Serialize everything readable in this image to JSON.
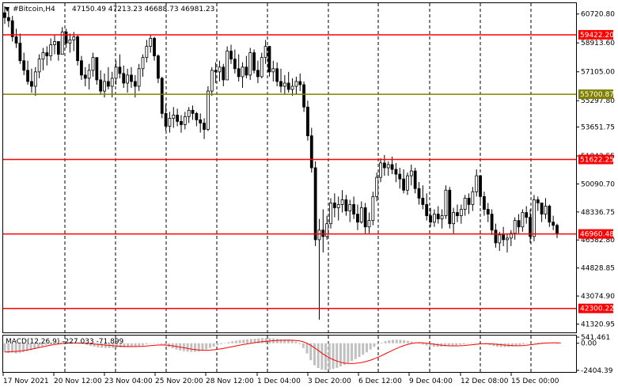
{
  "header": {
    "symbol": "#Bitcoin,H4",
    "ohlc": "47150.49 47213.23 46688.73 46981.23"
  },
  "chart_data": {
    "type": "candlestick",
    "timeframe": "H4",
    "price_ylim": [
      40800,
      61400
    ],
    "price_ticks": [
      60720.8,
      58913.6,
      57105.0,
      55297.8,
      53651.75,
      51843.55,
      50090.7,
      48336.75,
      46582.8,
      44828.85,
      43074.9,
      41320.95
    ],
    "price_tick_labels": [
      "60720.80",
      "58913.60",
      "57105.00",
      "55297.80",
      "53651.75",
      "51843.55",
      "50090.70",
      "48336.75",
      "46582.80",
      "44828.85",
      "43074.90",
      "41320.95"
    ],
    "levels": [
      {
        "price": 59422.2,
        "label": "59422.20",
        "color": "#ff0000"
      },
      {
        "price": 55700.87,
        "label": "55700.87",
        "color": "#808000"
      },
      {
        "price": 51622.25,
        "label": "51622.25",
        "color": "#ff0000"
      },
      {
        "price": 46960.48,
        "label": "46960.48",
        "color": "#ff0000"
      },
      {
        "price": 42300.22,
        "label": "42300.22",
        "color": "#ff0000"
      }
    ],
    "x_labels": [
      "17 Nov 2021",
      "20 Nov 12:00",
      "23 Nov 04:00",
      "25 Nov 20:00",
      "28 Nov 12:00",
      "1 Dec 04:00",
      "3 Dec 20:00",
      "6 Dec 12:00",
      "9 Dec 04:00",
      "12 Dec 08:00",
      "15 Dec 00:00"
    ],
    "candles_hlc": [
      [
        61200,
        60100,
        60500
      ],
      [
        61100,
        59900,
        60300
      ],
      [
        60600,
        59000,
        59300
      ],
      [
        59800,
        58600,
        58900
      ],
      [
        59500,
        57600,
        57800
      ],
      [
        58300,
        56900,
        57200
      ],
      [
        57800,
        56300,
        56500
      ],
      [
        57300,
        55800,
        56200
      ],
      [
        57400,
        55600,
        57100
      ],
      [
        58200,
        56700,
        57900
      ],
      [
        58600,
        57200,
        58300
      ],
      [
        58700,
        57500,
        58100
      ],
      [
        59200,
        57800,
        58800
      ],
      [
        59400,
        58200,
        59000
      ],
      [
        59000,
        57800,
        58200
      ],
      [
        59900,
        58500,
        59600
      ],
      [
        59800,
        58600,
        58900
      ],
      [
        59500,
        58300,
        59100
      ],
      [
        59600,
        58400,
        59300
      ],
      [
        59400,
        57500,
        57800
      ],
      [
        58100,
        56600,
        56900
      ],
      [
        57400,
        56200,
        56700
      ],
      [
        57600,
        56000,
        57200
      ],
      [
        58300,
        56800,
        58000
      ],
      [
        58000,
        56300,
        56600
      ],
      [
        57200,
        55700,
        55900
      ],
      [
        57000,
        55500,
        56500
      ],
      [
        57400,
        56000,
        56200
      ],
      [
        57100,
        55500,
        56700
      ],
      [
        57800,
        56300,
        57400
      ],
      [
        58200,
        56700,
        57000
      ],
      [
        57500,
        56100,
        56400
      ],
      [
        57300,
        55800,
        56900
      ],
      [
        57400,
        56100,
        56500
      ],
      [
        56900,
        55500,
        56200
      ],
      [
        57600,
        55900,
        57300
      ],
      [
        58200,
        56800,
        58000
      ],
      [
        59100,
        57700,
        58700
      ],
      [
        59400,
        58300,
        59200
      ],
      [
        59300,
        57800,
        58100
      ],
      [
        58200,
        56400,
        56700
      ],
      [
        56800,
        54200,
        54500
      ],
      [
        55100,
        53400,
        53700
      ],
      [
        54600,
        53300,
        54200
      ],
      [
        54900,
        53600,
        54400
      ],
      [
        54800,
        53700,
        54000
      ],
      [
        54400,
        53300,
        53800
      ],
      [
        54600,
        53500,
        54300
      ],
      [
        54900,
        53900,
        54700
      ],
      [
        55000,
        54100,
        54500
      ],
      [
        54600,
        53700,
        54100
      ],
      [
        54500,
        53300,
        53900
      ],
      [
        54200,
        52900,
        53500
      ],
      [
        56200,
        53400,
        55900
      ],
      [
        57400,
        55600,
        57200
      ],
      [
        57700,
        56400,
        57100
      ],
      [
        57800,
        56500,
        57400
      ],
      [
        57600,
        56200,
        56600
      ],
      [
        58700,
        56800,
        58400
      ],
      [
        58800,
        57600,
        57900
      ],
      [
        58500,
        57000,
        57300
      ],
      [
        58200,
        56500,
        56800
      ],
      [
        57700,
        56100,
        57400
      ],
      [
        58100,
        56700,
        56900
      ],
      [
        58600,
        56600,
        58300
      ],
      [
        58500,
        57000,
        57200
      ],
      [
        57800,
        56400,
        56800
      ],
      [
        58300,
        56700,
        58000
      ],
      [
        59100,
        57600,
        58700
      ],
      [
        58500,
        56800,
        57100
      ],
      [
        57800,
        56500,
        57300
      ],
      [
        57700,
        56200,
        56500
      ],
      [
        57300,
        55800,
        56200
      ],
      [
        56900,
        55700,
        56400
      ],
      [
        57100,
        55800,
        56000
      ],
      [
        56700,
        55600,
        56200
      ],
      [
        56800,
        55700,
        56500
      ],
      [
        57000,
        55900,
        56300
      ],
      [
        56500,
        54600,
        54900
      ],
      [
        55300,
        52800,
        53100
      ],
      [
        53600,
        50800,
        51100
      ],
      [
        51500,
        46200,
        46600
      ],
      [
        47900,
        41600,
        47200
      ],
      [
        48500,
        45800,
        46800
      ],
      [
        48100,
        46600,
        47600
      ],
      [
        49200,
        47300,
        48900
      ],
      [
        49500,
        48000,
        48600
      ],
      [
        49300,
        47800,
        48800
      ],
      [
        49700,
        48300,
        49100
      ],
      [
        49400,
        48100,
        48400
      ],
      [
        49100,
        47700,
        48800
      ],
      [
        49300,
        47900,
        48200
      ],
      [
        48800,
        47200,
        47700
      ],
      [
        49000,
        47600,
        48600
      ],
      [
        48900,
        47000,
        47400
      ],
      [
        48300,
        47000,
        47800
      ],
      [
        49600,
        47500,
        49300
      ],
      [
        50800,
        49000,
        50500
      ],
      [
        51700,
        50200,
        51400
      ],
      [
        51900,
        50600,
        51100
      ],
      [
        51500,
        50600,
        51300
      ],
      [
        51800,
        50700,
        51000
      ],
      [
        51400,
        50200,
        50700
      ],
      [
        51100,
        49800,
        50400
      ],
      [
        51000,
        49500,
        49700
      ],
      [
        50800,
        49400,
        50600
      ],
      [
        51300,
        50000,
        50900
      ],
      [
        51100,
        49500,
        49800
      ],
      [
        50200,
        48800,
        49200
      ],
      [
        50000,
        48500,
        48800
      ],
      [
        49500,
        47800,
        48100
      ],
      [
        48600,
        47400,
        47700
      ],
      [
        48500,
        47400,
        48200
      ],
      [
        48700,
        47600,
        47900
      ],
      [
        48500,
        47300,
        48100
      ],
      [
        50000,
        47900,
        49700
      ],
      [
        49900,
        47300,
        47600
      ],
      [
        48600,
        47000,
        48300
      ],
      [
        48800,
        47700,
        48100
      ],
      [
        48800,
        47600,
        48500
      ],
      [
        49400,
        48100,
        49200
      ],
      [
        49500,
        48200,
        48800
      ],
      [
        49900,
        48400,
        49600
      ],
      [
        51000,
        49300,
        50600
      ],
      [
        50500,
        48900,
        49300
      ],
      [
        49600,
        48100,
        48500
      ],
      [
        48900,
        47700,
        48200
      ],
      [
        48500,
        46900,
        47200
      ],
      [
        47600,
        46100,
        46400
      ],
      [
        47100,
        45900,
        46900
      ],
      [
        47400,
        46200,
        46600
      ],
      [
        47000,
        45800,
        46700
      ],
      [
        47200,
        46200,
        47000
      ],
      [
        48000,
        46600,
        47800
      ],
      [
        48200,
        47000,
        47400
      ],
      [
        48500,
        47100,
        48300
      ],
      [
        48700,
        47600,
        48000
      ],
      [
        48500,
        46400,
        46800
      ],
      [
        49400,
        46500,
        49100
      ],
      [
        49300,
        48400,
        48900
      ],
      [
        48900,
        47700,
        48200
      ],
      [
        49200,
        47900,
        48700
      ],
      [
        48800,
        47400,
        47700
      ],
      [
        48100,
        47200,
        47500
      ],
      [
        47600,
        46700,
        46950
      ]
    ],
    "macd": {
      "label": "MACD(12,26,9) -227.033 -71.899",
      "ticks": [
        "541.461",
        "0.00",
        "-2404.39"
      ],
      "ylim": [
        -2404.39,
        541.461
      ],
      "histogram": [
        -800,
        -850,
        -820,
        -900,
        -850,
        -780,
        -700,
        -620,
        -500,
        -380,
        -250,
        -140,
        -60,
        20,
        60,
        90,
        110,
        120,
        100,
        60,
        10,
        -70,
        -150,
        -230,
        -300,
        -360,
        -400,
        -420,
        -430,
        -420,
        -400,
        -380,
        -360,
        -350,
        -340,
        -300,
        -240,
        -180,
        -100,
        -30,
        20,
        0,
        -80,
        -200,
        -330,
        -450,
        -560,
        -640,
        -700,
        -740,
        -760,
        -760,
        -740,
        -650,
        -540,
        -420,
        -300,
        -190,
        -80,
        20,
        100,
        170,
        230,
        280,
        320,
        350,
        380,
        400,
        430,
        450,
        460,
        450,
        430,
        400,
        360,
        330,
        300,
        260,
        150,
        -80,
        -420,
        -900,
        -1500,
        -1950,
        -2200,
        -2330,
        -2380,
        -2350,
        -2280,
        -2180,
        -2050,
        -1900,
        -1740,
        -1570,
        -1400,
        -1220,
        -1020,
        -800,
        -560,
        -320,
        -100,
        60,
        180,
        260,
        300,
        320,
        300,
        270,
        220,
        150,
        60,
        -30,
        -120,
        -200,
        -260,
        -300,
        -320,
        -300,
        -270,
        -240,
        -210,
        -180,
        -140,
        -90,
        -30,
        20,
        40,
        30,
        -20,
        -90,
        -170,
        -240,
        -300,
        -330,
        -340,
        -320,
        -280,
        -230,
        -170,
        -100,
        -40,
        10,
        40,
        60,
        70,
        60,
        30,
        -20,
        -60
      ],
      "signal": [
        -780,
        -760,
        -740,
        -720,
        -690,
        -650,
        -600,
        -540,
        -470,
        -400,
        -330,
        -260,
        -190,
        -130,
        -80,
        -40,
        -10,
        10,
        20,
        20,
        15,
        5,
        -15,
        -40,
        -70,
        -100,
        -130,
        -160,
        -190,
        -220,
        -245,
        -265,
        -280,
        -290,
        -295,
        -290,
        -280,
        -265,
        -245,
        -215,
        -185,
        -160,
        -150,
        -160,
        -190,
        -230,
        -280,
        -340,
        -400,
        -460,
        -515,
        -560,
        -600,
        -620,
        -625,
        -610,
        -580,
        -540,
        -490,
        -430,
        -365,
        -300,
        -235,
        -170,
        -110,
        -55,
        0,
        50,
        95,
        135,
        170,
        200,
        225,
        245,
        260,
        270,
        275,
        270,
        250,
        210,
        130,
        0,
        -180,
        -400,
        -640,
        -880,
        -1100,
        -1290,
        -1450,
        -1580,
        -1680,
        -1750,
        -1790,
        -1800,
        -1780,
        -1740,
        -1680,
        -1600,
        -1500,
        -1380,
        -1240,
        -1090,
        -930,
        -770,
        -610,
        -460,
        -320,
        -200,
        -100,
        -20,
        30,
        50,
        40,
        10,
        -30,
        -80,
        -130,
        -170,
        -200,
        -220,
        -230,
        -230,
        -220,
        -200,
        -170,
        -140,
        -105,
        -70,
        -45,
        -40,
        -50,
        -70,
        -100,
        -130,
        -160,
        -190,
        -210,
        -220,
        -220,
        -200,
        -170,
        -130,
        -90,
        -50,
        -15,
        15,
        35,
        45,
        40,
        20
      ]
    }
  }
}
